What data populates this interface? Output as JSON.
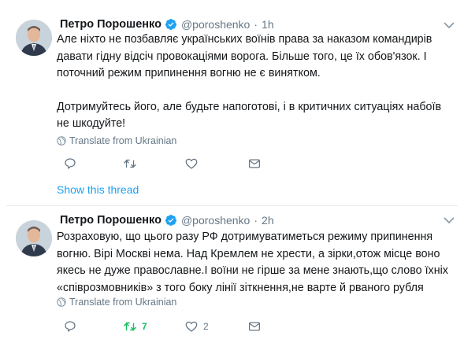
{
  "tweets": [
    {
      "author_name": "Петро Порошенко",
      "handle": "@poroshenko",
      "separator": "·",
      "time": "1h",
      "paragraphs": [
        "Але ніхто не позбавляє українських воїнів права за наказом командирів давати гідну відсіч провокаціями ворога. Більше того, це їх обов'язок. І поточний режим припинення вогню не є винятком.",
        "Дотримуйтесь його, але будьте напоготові, і в критичних ситуаціях набоїв не шкодуйте!"
      ],
      "translate_label": "Translate from Ukrainian",
      "reply_count": "",
      "retweet_count": "",
      "like_count": "",
      "show_thread": "Show this thread"
    },
    {
      "author_name": "Петро Порошенко",
      "handle": "@poroshenko",
      "separator": "·",
      "time": "2h",
      "paragraphs": [
        "Розраховую, що цього разу РФ дотримуватиметься режиму припинення вогню. Вірі Москві нема. Над Кремлем не хрести, а зірки,отож місце воно якесь не дуже православне.І воїни не гірше за мене знають,що слово їхніх «співрозмовників» з того боку лінії зіткнення,не варте й рваного рубля"
      ],
      "translate_label": "Translate from Ukrainian",
      "reply_count": "",
      "retweet_count": "7",
      "like_count": "2"
    }
  ],
  "colors": {
    "text": "#14171a",
    "muted": "#657786",
    "link": "#1da1f2",
    "verified": "#1da1f2",
    "retweeted": "#17bf63",
    "divider": "#e6ecf0"
  },
  "icons": [
    "verified-badge-icon",
    "chevron-down-icon",
    "globe-icon",
    "reply-icon",
    "retweet-icon",
    "like-icon",
    "direct-message-icon"
  ]
}
